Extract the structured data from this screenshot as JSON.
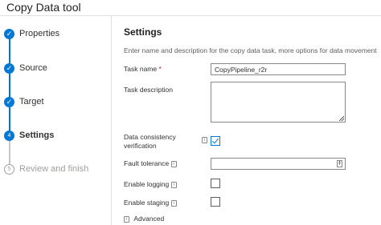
{
  "window": {
    "title": "Copy Data tool"
  },
  "steps": [
    {
      "label": "Properties",
      "status": "complete",
      "icon": "check-icon",
      "glyph": "✓"
    },
    {
      "label": "Source",
      "status": "complete",
      "icon": "check-icon",
      "glyph": "✓"
    },
    {
      "label": "Target",
      "status": "complete",
      "icon": "check-icon",
      "glyph": "✓"
    },
    {
      "label": "Settings",
      "status": "active",
      "number": "4"
    },
    {
      "label": "Review and finish",
      "status": "pending",
      "number": "5"
    }
  ],
  "settings": {
    "title": "Settings",
    "description": "Enter name and description for the copy data task, more options for data movement",
    "task_name": {
      "label": "Task name",
      "required_mark": "*",
      "value": "CopyPipeline_r2r"
    },
    "task_description": {
      "label": "Task description",
      "value": ""
    },
    "data_consistency": {
      "label_line1": "Data consistency",
      "label_line2": "verification",
      "checked": true
    },
    "fault_tolerance": {
      "label": "Fault tolerance",
      "value": ""
    },
    "enable_logging": {
      "label": "Enable logging",
      "checked": false
    },
    "enable_staging": {
      "label": "Enable staging",
      "checked": false
    },
    "advanced": {
      "label": "Advanced"
    }
  },
  "colors": {
    "accent": "#0078d4",
    "required": "#a4262c",
    "pending": "#a19f9d"
  }
}
